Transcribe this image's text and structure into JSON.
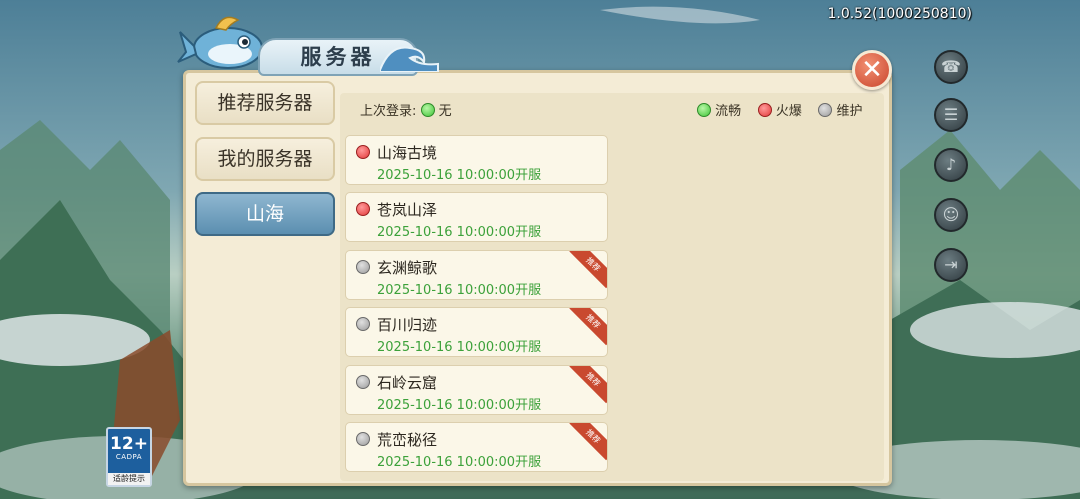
{
  "version": "1.0.52(1000250810)",
  "panel_title": "服务器",
  "tabs": [
    {
      "label": "推荐服务器",
      "active": false
    },
    {
      "label": "我的服务器",
      "active": false
    },
    {
      "label": "山海",
      "active": true
    }
  ],
  "last_login": {
    "label": "上次登录:",
    "value": "无",
    "status": "green"
  },
  "legend": [
    {
      "label": "流畅",
      "status": "green"
    },
    {
      "label": "火爆",
      "status": "red"
    },
    {
      "label": "维护",
      "status": "gray"
    }
  ],
  "servers": [
    {
      "name": "山海古境",
      "time": "2025-10-16 10:00:00开服",
      "status": "red",
      "badge": ""
    },
    {
      "name": "苍岚山泽",
      "time": "2025-10-16 10:00:00开服",
      "status": "red",
      "badge": ""
    },
    {
      "name": "玄渊鲸歌",
      "time": "2025-10-16 10:00:00开服",
      "status": "gray",
      "badge": "推荐"
    },
    {
      "name": "百川归迹",
      "time": "2025-10-16 10:00:00开服",
      "status": "gray",
      "badge": "推荐"
    },
    {
      "name": "石岭云窟",
      "time": "2025-10-16 10:00:00开服",
      "status": "gray",
      "badge": "推荐"
    },
    {
      "name": "荒峦秘径",
      "time": "2025-10-16 10:00:00开服",
      "status": "gray",
      "badge": "推荐"
    }
  ],
  "age_badge": {
    "number": "12+",
    "org": "CADPA",
    "tip": "适龄提示"
  },
  "side_menu_icons": [
    "headset-icon",
    "notice-icon",
    "sound-icon",
    "user-center-icon",
    "exit-icon"
  ],
  "colors": {
    "status_green": "#3fc437",
    "status_red": "#e23a3a",
    "status_gray": "#9c9c9c",
    "time_green": "#3ca13a",
    "active_tab": "#5b8fb0"
  }
}
